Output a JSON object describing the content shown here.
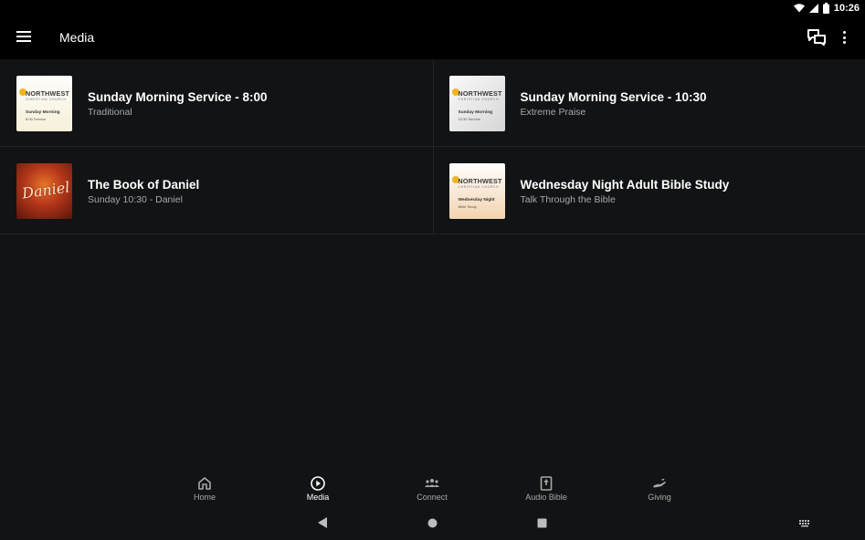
{
  "status_bar": {
    "time": "10:26",
    "icons": [
      "wifi-icon",
      "cell-signal-icon",
      "battery-icon"
    ]
  },
  "app_bar": {
    "title": "Media",
    "icons": [
      "menu-icon",
      "chat-icon",
      "more-vert-icon"
    ]
  },
  "media_items": [
    {
      "title": "Sunday Morning Service - 8:00",
      "subtitle": "Traditional",
      "thumb": {
        "brand": "NORTHWEST",
        "brand_sub": "CHRISTIAN CHURCH",
        "line1": "Sunday Morning",
        "line2": "8:00 Service"
      }
    },
    {
      "title": "Sunday Morning Service - 10:30",
      "subtitle": "Extreme Praise",
      "thumb": {
        "brand": "NORTHWEST",
        "brand_sub": "CHRISTIAN CHURCH",
        "line1": "Sunday Morning",
        "line2": "10:30 Service"
      }
    },
    {
      "title": "The Book of Daniel",
      "subtitle": "Sunday 10:30 - Daniel",
      "thumb": {
        "art_text": "Daniel"
      }
    },
    {
      "title": "Wednesday Night Adult Bible Study",
      "subtitle": "Talk Through the Bible",
      "thumb": {
        "brand": "NORTHWEST",
        "brand_sub": "CHRISTIAN CHURCH",
        "line1": "Wednesday Night",
        "line2": "Bible Study"
      }
    }
  ],
  "bottom_nav": [
    {
      "label": "Home",
      "icon": "home-icon",
      "active": false
    },
    {
      "label": "Media",
      "icon": "play-circle-icon",
      "active": true
    },
    {
      "label": "Connect",
      "icon": "group-icon",
      "active": false
    },
    {
      "label": "Audio Bible",
      "icon": "bible-icon",
      "active": false
    },
    {
      "label": "Giving",
      "icon": "giving-hand-icon",
      "active": false
    }
  ],
  "system_nav": [
    "back-icon",
    "home-circle-icon",
    "recents-icon",
    "keyboard-icon"
  ],
  "colors": {
    "background": "#121314",
    "app_bar": "#000000",
    "divider": "#232425",
    "subtitle": "#a8a8a8",
    "inactive_nav": "#a8a8a8"
  }
}
